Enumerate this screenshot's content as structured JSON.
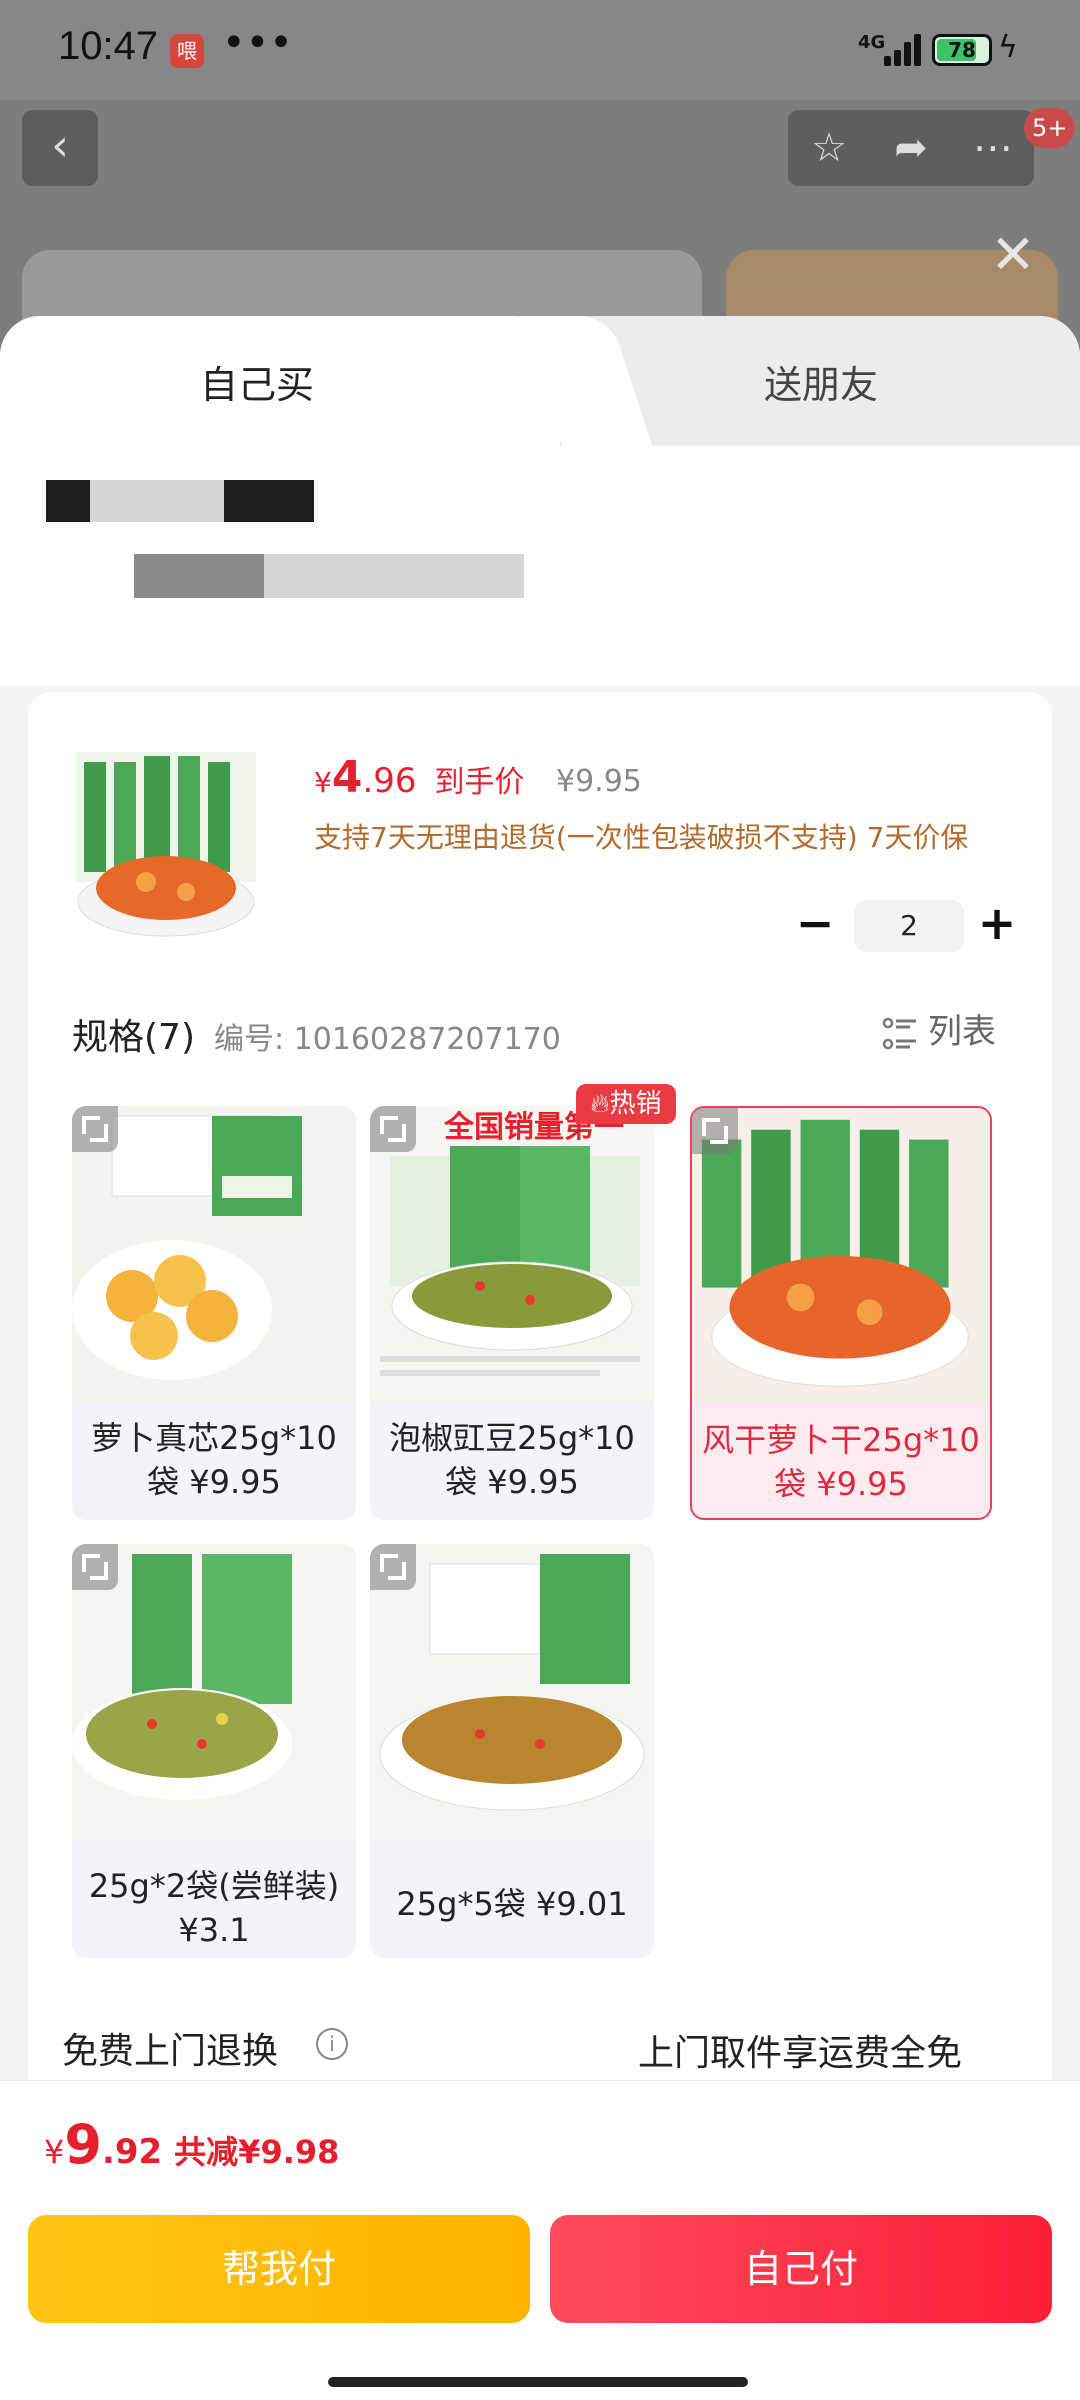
{
  "status": {
    "time": "10:47",
    "app_badge": "喂",
    "more": "•••",
    "network": "4G",
    "battery": "78",
    "battery_level": 0.78
  },
  "header": {
    "notification_count": "5+"
  },
  "tabs": [
    {
      "label": "自己买",
      "active": true
    },
    {
      "label": "送朋友",
      "active": false
    }
  ],
  "product": {
    "price_symbol": "¥",
    "price_int": "4",
    "price_dec": ".96",
    "price_label": "到手价",
    "original_price": "¥9.95",
    "policy": "支持7天无理由退货(一次性包装破损不支持) 7天价保",
    "quantity": "2"
  },
  "spec": {
    "title": "规格(7)",
    "code": "编号: 10160287207170",
    "list_label": "列表",
    "hot_tag": "热销",
    "hot_banner": "全国销量第一",
    "items": [
      {
        "label": "萝卜真芯25g*10袋 ¥9.95",
        "selected": false
      },
      {
        "label": "泡椒豇豆25g*10袋 ¥9.95",
        "selected": false
      },
      {
        "label": "风干萝卜干25g*10袋 ¥9.95",
        "selected": true
      },
      {
        "label": "25g*2袋(尝鲜装)¥3.1",
        "selected": false
      },
      {
        "label": "25g*5袋 ¥9.01",
        "selected": false
      }
    ]
  },
  "service": {
    "title": "免费上门退换",
    "desc": "上门取件享运费全免"
  },
  "footer": {
    "total_symbol": "¥",
    "total_int": "9",
    "total_dec": ".92",
    "discount": "共减¥9.98",
    "help_pay": "帮我付",
    "self_pay": "自己付"
  },
  "colors": {
    "accent_red": "#e5212e",
    "accent_yellow": "#ffbe0f",
    "policy_brown": "#b56a2a"
  }
}
